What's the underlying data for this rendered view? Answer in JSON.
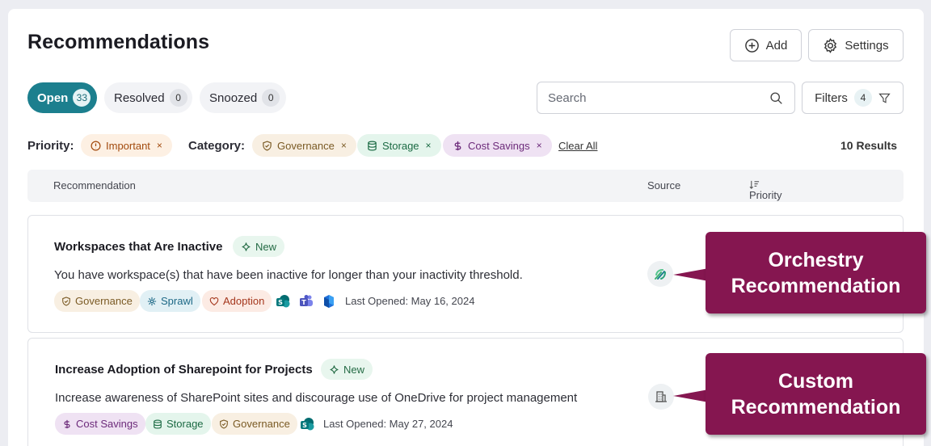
{
  "page": {
    "title": "Recommendations"
  },
  "header": {
    "add_label": "Add",
    "settings_label": "Settings"
  },
  "tabs": [
    {
      "label": "Open",
      "count": "33",
      "active": true
    },
    {
      "label": "Resolved",
      "count": "0"
    },
    {
      "label": "Snoozed",
      "count": "0"
    }
  ],
  "search": {
    "placeholder": "Search"
  },
  "filters": {
    "label": "Filters",
    "count": "4"
  },
  "active_filters": {
    "priority_label": "Priority:",
    "priority_chips": [
      "Important"
    ],
    "category_label": "Category:",
    "category_chips": [
      "Governance",
      "Storage",
      "Cost Savings"
    ],
    "clear_label": "Clear All",
    "remove_glyph": "×"
  },
  "results_text": "10 Results",
  "table": {
    "col_recommendation": "Recommendation",
    "col_source": "Source",
    "col_priority": "Priority"
  },
  "rows": [
    {
      "title": "Workspaces that Are Inactive",
      "badge": "New",
      "description": "You have workspace(s) that have been inactive for longer than your inactivity threshold.",
      "tags": [
        "Governance",
        "Sprawl",
        "Adoption"
      ],
      "apps": [
        "sharepoint-icon",
        "teams-icon",
        "m365-icon"
      ],
      "last_opened": "Last Opened: May 16, 2024",
      "source_icon": "orchestry-icon"
    },
    {
      "title": "Increase Adoption of Sharepoint for Projects",
      "badge": "New",
      "description": "Increase awareness of SharePoint sites and discourage use of OneDrive for project management",
      "tags": [
        "Cost Savings",
        "Storage",
        "Governance"
      ],
      "apps": [
        "sharepoint-icon"
      ],
      "last_opened": "Last Opened: May 27, 2024",
      "source_icon": "building-icon"
    }
  ],
  "callouts": [
    {
      "line1": "Orchestry",
      "line2": "Recommendation"
    },
    {
      "line1": "Custom",
      "line2": "Recommendation"
    }
  ],
  "colors": {
    "accent": "#1c7f8e",
    "callout": "#851650"
  }
}
